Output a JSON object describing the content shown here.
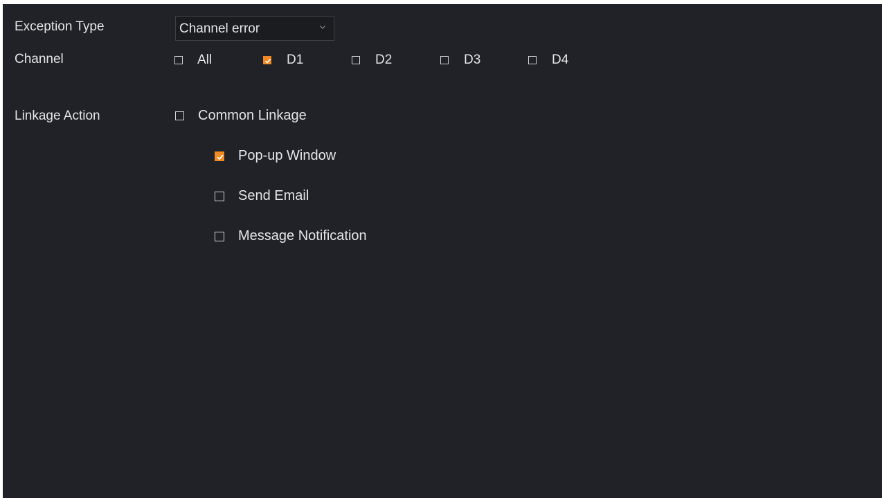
{
  "exception": {
    "label": "Exception Type",
    "selected": "Channel error"
  },
  "channel": {
    "label": "Channel",
    "options": [
      {
        "label": "All",
        "checked": false
      },
      {
        "label": "D1",
        "checked": true
      },
      {
        "label": "D2",
        "checked": false
      },
      {
        "label": "D3",
        "checked": false
      },
      {
        "label": "D4",
        "checked": false
      }
    ]
  },
  "linkage": {
    "label": "Linkage Action",
    "common": {
      "label": "Common Linkage",
      "checked": false
    },
    "items": [
      {
        "label": "Pop-up Window",
        "checked": true
      },
      {
        "label": "Send Email",
        "checked": false
      },
      {
        "label": "Message Notification",
        "checked": false
      }
    ]
  },
  "colors": {
    "background": "#202227",
    "accent": "#f08a24",
    "text": "#e4e5e8"
  }
}
